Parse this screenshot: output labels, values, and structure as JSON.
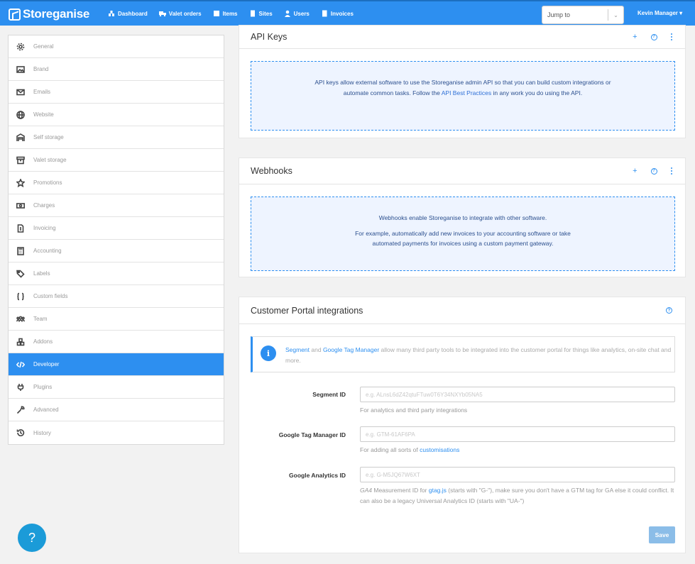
{
  "brand": "Storeganise",
  "nav": [
    "Dashboard",
    "Valet orders",
    "Items",
    "Sites",
    "Users",
    "Invoices"
  ],
  "nav_icons": [
    "dashboard-icon",
    "truck-icon",
    "list-icon",
    "building-icon",
    "user-icon",
    "document-icon"
  ],
  "jump_to": "Jump to",
  "user_menu": "Kevin Manager ▾",
  "sidebar": {
    "active": "Developer",
    "items": [
      {
        "label": "General",
        "icon": "gear-icon"
      },
      {
        "label": "Brand",
        "icon": "image-icon"
      },
      {
        "label": "Emails",
        "icon": "envelope-icon"
      },
      {
        "label": "Website",
        "icon": "globe-icon"
      },
      {
        "label": "Self storage",
        "icon": "warehouse-icon"
      },
      {
        "label": "Valet storage",
        "icon": "archive-icon"
      },
      {
        "label": "Promotions",
        "icon": "star-icon"
      },
      {
        "label": "Charges",
        "icon": "money-icon"
      },
      {
        "label": "Invoicing",
        "icon": "invoice-icon"
      },
      {
        "label": "Accounting",
        "icon": "calculator-icon"
      },
      {
        "label": "Labels",
        "icon": "tags-icon"
      },
      {
        "label": "Custom fields",
        "icon": "braces-icon"
      },
      {
        "label": "Team",
        "icon": "team-icon"
      },
      {
        "label": "Addons",
        "icon": "cubes-icon"
      },
      {
        "label": "Developer",
        "icon": "code-icon"
      },
      {
        "label": "Plugins",
        "icon": "plug-icon"
      },
      {
        "label": "Advanced",
        "icon": "wrench-icon"
      },
      {
        "label": "History",
        "icon": "history-icon"
      }
    ]
  },
  "api_keys": {
    "title": "API Keys",
    "text_before": "API keys allow external software to use the Storeganise admin API so that you can build custom integrations or automate common tasks. Follow the ",
    "link": "API Best Practices",
    "text_after": " in any work you do using the API."
  },
  "webhooks": {
    "title": "Webhooks",
    "line1": "Webhooks enable Storeganise to integrate with other software.",
    "line2": "For example, automatically add new invoices to your accounting software or take automated payments for invoices using a custom payment gateway."
  },
  "portal": {
    "title": "Customer Portal integrations",
    "alert_link1": "Segment",
    "alert_and": " and ",
    "alert_link2": "Google Tag Manager",
    "alert_rest": " allow many third party tools to be integrated into the customer portal for things like analytics, on-site chat and more.",
    "segment_label": "Segment ID",
    "segment_placeholder": "e.g. ALnsL6dZ42qtuFTuw0T6Y34NXYb05NA5",
    "segment_help": "For analytics and third party integrations",
    "gtm_label": "Google Tag Manager ID",
    "gtm_placeholder": "e.g. GTM-61AF6PA",
    "gtm_help_before": "For adding all sorts of ",
    "gtm_help_link": "customisations",
    "ga_label": "Google Analytics ID",
    "ga_placeholder": "e.g. G-M5JQ67W6XT",
    "ga_help_ga4": "GA4",
    "ga_help_1": " Measurement ID for ",
    "ga_help_link": "gtag.js",
    "ga_help_2": " (starts with \"G-\"), make sure you don't have a GTM tag for GA else it could conflict. It can also be a legacy Universal Analytics ID (starts with \"UA-\")",
    "save": "Save"
  },
  "help_button": "?"
}
